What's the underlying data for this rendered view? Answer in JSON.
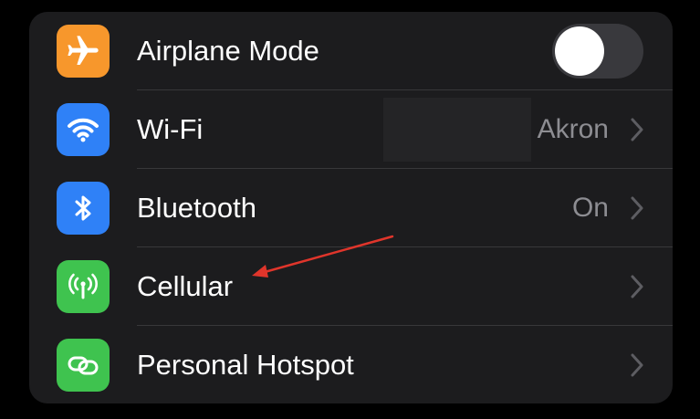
{
  "settings": {
    "rows": [
      {
        "label": "Airplane Mode",
        "icon": "airplane-icon",
        "tile_color": "#f7972c",
        "toggle_on": false
      },
      {
        "label": "Wi-Fi",
        "icon": "wifi-icon",
        "tile_color": "#2f81f7",
        "value": "Akron"
      },
      {
        "label": "Bluetooth",
        "icon": "bluetooth-icon",
        "tile_color": "#2f81f7",
        "value": "On"
      },
      {
        "label": "Cellular",
        "icon": "antenna-icon",
        "tile_color": "#3fc34f"
      },
      {
        "label": "Personal Hotspot",
        "icon": "link-icon",
        "tile_color": "#3fc34f"
      }
    ]
  },
  "annotation": {
    "arrow_color": "#e0352b",
    "arrow_target": "cellular"
  }
}
